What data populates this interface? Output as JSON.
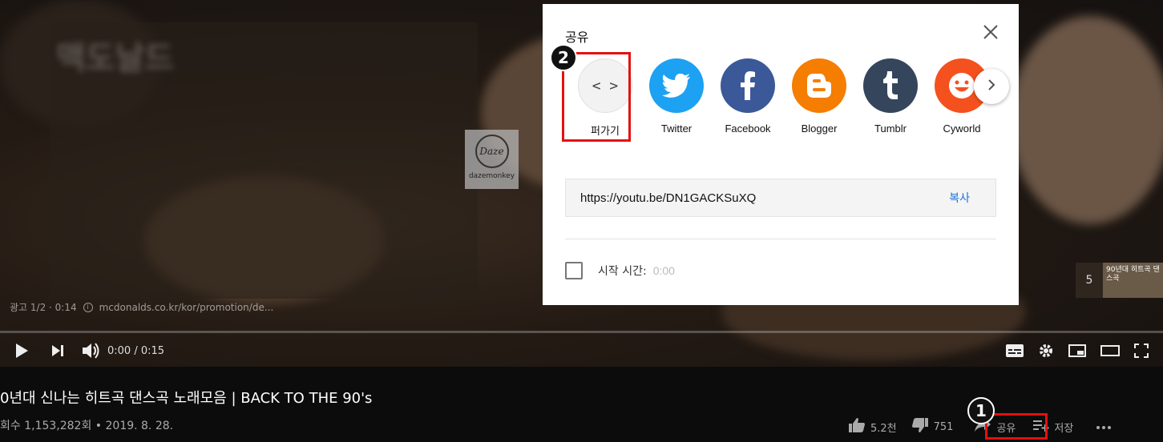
{
  "player": {
    "watermark_text": "dazemonkey",
    "watermark_logo": "Daze",
    "ad_label": "광고 1/2 · 0:14",
    "ad_url": "mcdonalds.co.kr/kor/promotion/de...",
    "time": "0:00 / 0:15",
    "next_number": "5",
    "next_thumb_text": "90년대 히트곡 댄스곡"
  },
  "video": {
    "title": "0년대 신나는 히트곡 댄스곡 노래모음 | BACK TO THE 90's",
    "meta": "회수 1,153,282회 • 2019. 8. 28.",
    "likes": "5.2천",
    "dislikes": "751",
    "share_label": "공유",
    "save_label": "저장"
  },
  "dialog": {
    "title": "공유",
    "share_targets": [
      {
        "label": "퍼가기",
        "icon": "embed-icon",
        "color": "#f2f2f2"
      },
      {
        "label": "Twitter",
        "icon": "twitter-icon",
        "color": "#1da1f2"
      },
      {
        "label": "Facebook",
        "icon": "facebook-icon",
        "color": "#3b5998"
      },
      {
        "label": "Blogger",
        "icon": "blogger-icon",
        "color": "#f57d00"
      },
      {
        "label": "Tumblr",
        "icon": "tumblr-icon",
        "color": "#35465c"
      },
      {
        "label": "Cyworld",
        "icon": "cyworld-icon",
        "color": "#f4511e"
      }
    ],
    "url": "https://youtu.be/DN1GACKSuXQ",
    "copy_label": "복사",
    "start_label": "시작 시간:",
    "start_value": "0:00"
  },
  "annotations": {
    "badge_1": "1",
    "badge_2": "2",
    "highlight_color": "#e51010"
  }
}
